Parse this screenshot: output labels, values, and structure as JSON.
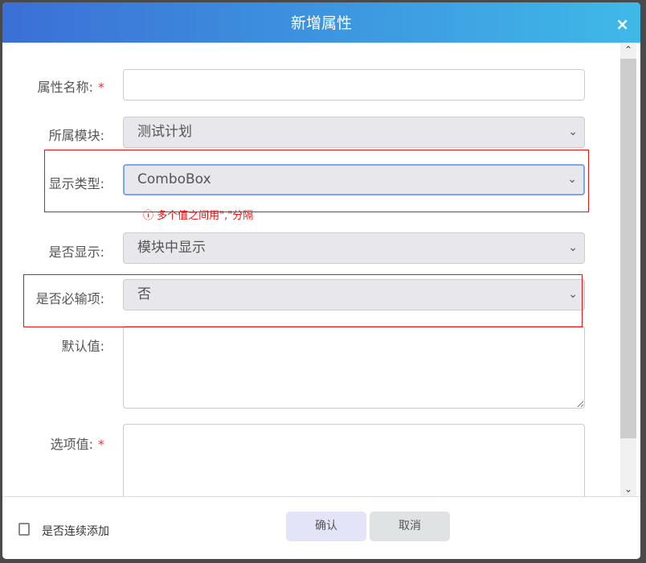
{
  "dialog": {
    "title": "新增属性",
    "close": "×"
  },
  "fields": {
    "name": {
      "label": "属性名称:",
      "required": "*",
      "value": ""
    },
    "module": {
      "label": "所属模块:",
      "value": "测试计划"
    },
    "display_type": {
      "label": "显示类型:",
      "value": "ComboBox",
      "hint": "ⓘ 多个值之间用\",\"分隔"
    },
    "visible": {
      "label": "是否显示:",
      "value": "模块中显示"
    },
    "required_field": {
      "label": "是否必输项:",
      "value": "否"
    },
    "default": {
      "label": "默认值:",
      "value": ""
    },
    "options": {
      "label": "选项值:",
      "required": "*",
      "value": ""
    }
  },
  "footer": {
    "continuous_add": "是否连续添加",
    "confirm": "确认",
    "cancel": "取消"
  },
  "icons": {
    "chevron": "⌄",
    "up": "⌃",
    "down": "⌄"
  }
}
